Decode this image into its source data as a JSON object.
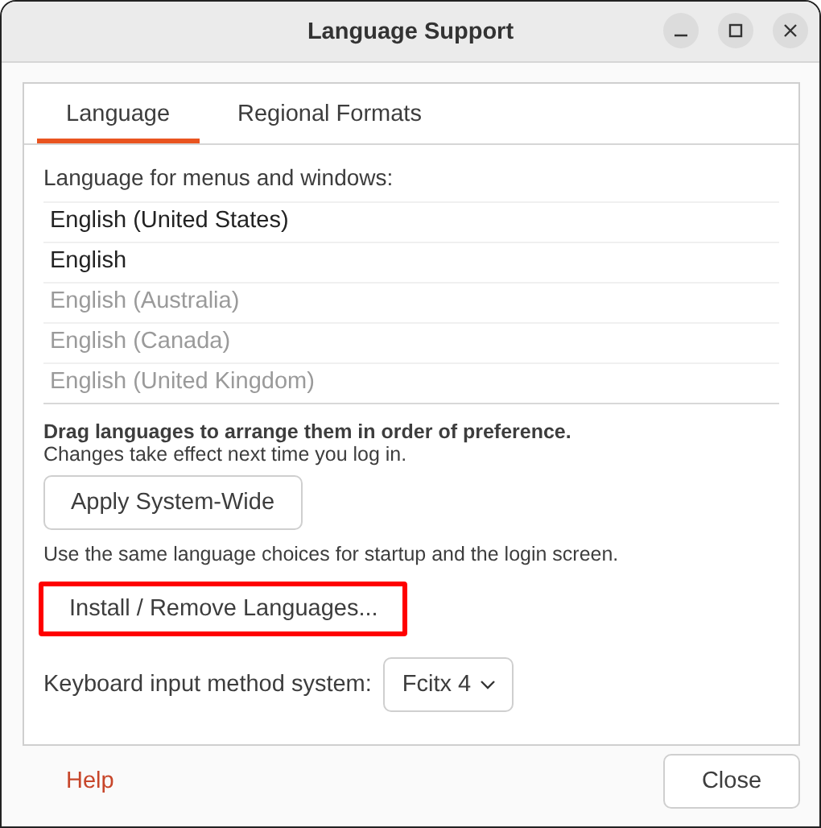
{
  "window": {
    "title": "Language Support"
  },
  "tabs": [
    {
      "label": "Language",
      "selected": true
    },
    {
      "label": "Regional Formats",
      "selected": false
    }
  ],
  "language_list": {
    "heading": "Language for menus and windows:",
    "items": [
      {
        "label": "English (United States)",
        "disabled": false
      },
      {
        "label": "English",
        "disabled": false
      },
      {
        "label": "English (Australia)",
        "disabled": true
      },
      {
        "label": "English (Canada)",
        "disabled": true
      },
      {
        "label": "English (United Kingdom)",
        "disabled": true
      }
    ]
  },
  "hint_bold": "Drag languages to arrange them in order of preference.",
  "hint": "Changes take effect next time you log in.",
  "apply_button": {
    "label": "Apply System-Wide",
    "highlighted": false
  },
  "apply_note": "Use the same language choices for startup and the login screen.",
  "install_button": {
    "label": "Install / Remove Languages...",
    "highlighted": true
  },
  "input_method": {
    "label": "Keyboard input method system:",
    "value": "Fcitx 4"
  },
  "help_link": "Help",
  "close_button": "Close"
}
